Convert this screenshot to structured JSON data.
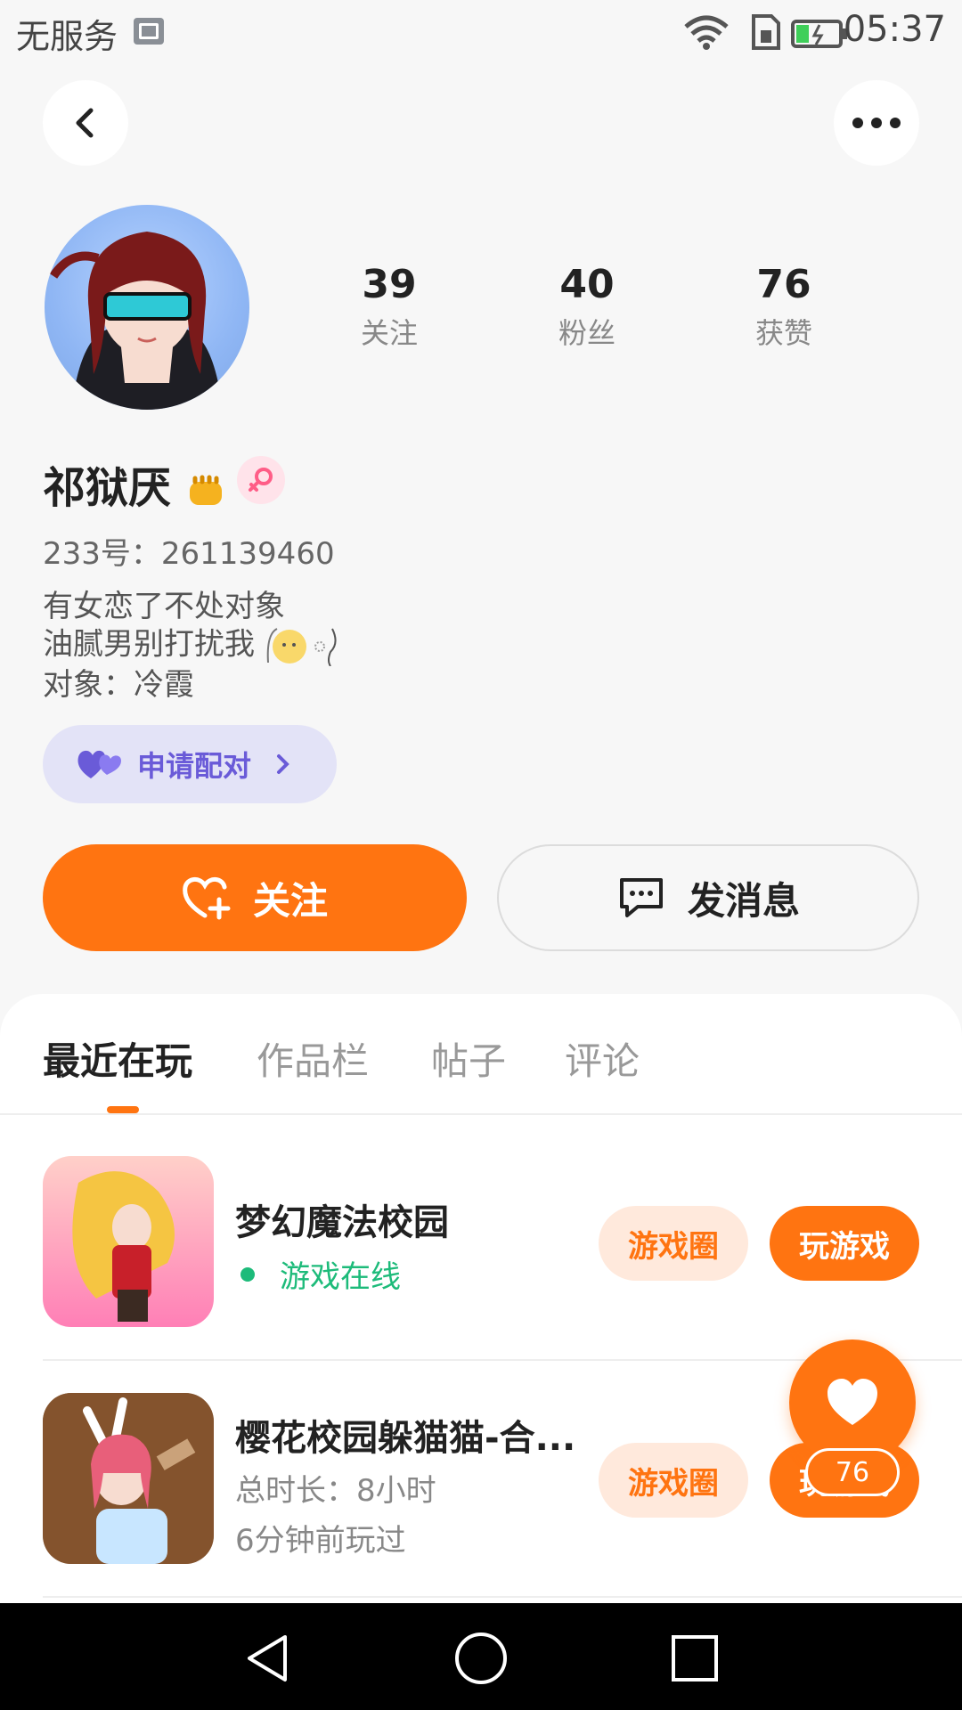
{
  "status_bar": {
    "carrier": "无服务",
    "time": "05:37"
  },
  "profile": {
    "stats": [
      {
        "value": "39",
        "label": "关注"
      },
      {
        "value": "40",
        "label": "粉丝"
      },
      {
        "value": "76",
        "label": "获赞"
      }
    ],
    "name": "祁狱厌",
    "uid": "233号：261139460",
    "bio": [
      "有女恋了不处对象",
      "油腻男别打扰我",
      "对象：冷霞"
    ],
    "pair_label": "申请配对"
  },
  "actions": {
    "follow_label": "关注",
    "message_label": "发消息"
  },
  "tabs": [
    {
      "label": "最近在玩",
      "active": true
    },
    {
      "label": "作品栏",
      "active": false
    },
    {
      "label": "帖子",
      "active": false
    },
    {
      "label": "评论",
      "active": false
    }
  ],
  "games": [
    {
      "title": "梦幻魔法校园",
      "status": "游戏在线",
      "circle_label": "游戏圈",
      "play_label": "玩游戏"
    },
    {
      "title": "樱花校园躲猫猫-合...",
      "duration": "总时长：8小时",
      "last_played": "6分钟前玩过",
      "circle_label": "游戏圈",
      "play_label": "玩游戏"
    }
  ],
  "like_fab": {
    "count": "76"
  },
  "colors": {
    "accent": "#ff7411",
    "online": "#1dbb7a",
    "pair": "#6a5bd8"
  }
}
